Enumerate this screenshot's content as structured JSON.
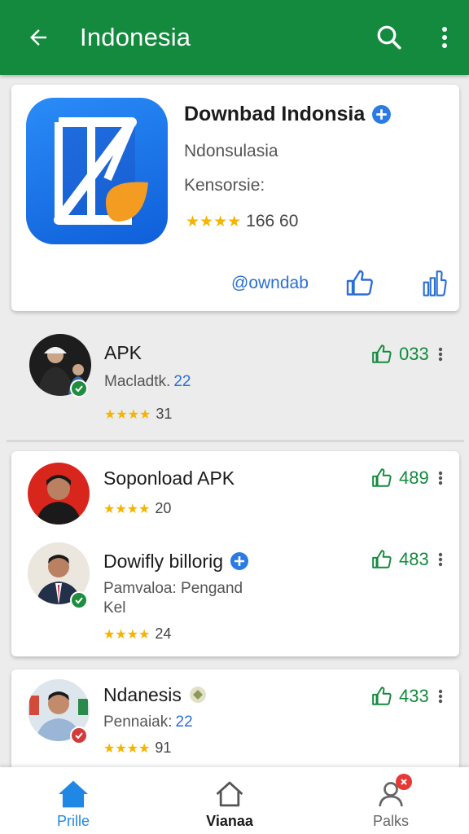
{
  "appbar": {
    "title": "Indonesia"
  },
  "featured": {
    "name": "Downbad Indonsia",
    "subtitle": "Ndonsulasia",
    "subtitle2": "Kensorsie:",
    "rating_text": "166  60",
    "rating_stars": "★★★★",
    "handle": "@owndab"
  },
  "items": [
    {
      "name": "APK",
      "meta_label": "Macladtk.",
      "meta_num": "22",
      "stars": "★★★★",
      "rating": "31",
      "likes": "033"
    },
    {
      "name": "Soponload APK",
      "stars": "★★★★",
      "rating": "20",
      "likes": "489"
    },
    {
      "name": "Dowifly billorig",
      "meta_label": "Pamvaloa: Pengand",
      "meta_line2": "Kel",
      "stars": "★★★★",
      "rating": "24",
      "likes": "483"
    },
    {
      "name": "Ndanesis",
      "meta_label": "Pennaiak:",
      "meta_num": "22",
      "stars": "★★★★",
      "rating": "91",
      "likes": "433"
    }
  ],
  "bottom_nav": [
    {
      "label": "Prille",
      "active": true
    },
    {
      "label": "Vianaa",
      "active": false
    },
    {
      "label": "Palks",
      "active": false
    }
  ],
  "colors": {
    "primary": "#138a3e",
    "link": "#2a6fd6",
    "star": "#f5b400"
  },
  "icons": [
    "arrow-left-icon",
    "search-icon",
    "more-vert-icon",
    "verified-icon",
    "thumb-up-icon",
    "home-icon",
    "profile-icon"
  ]
}
